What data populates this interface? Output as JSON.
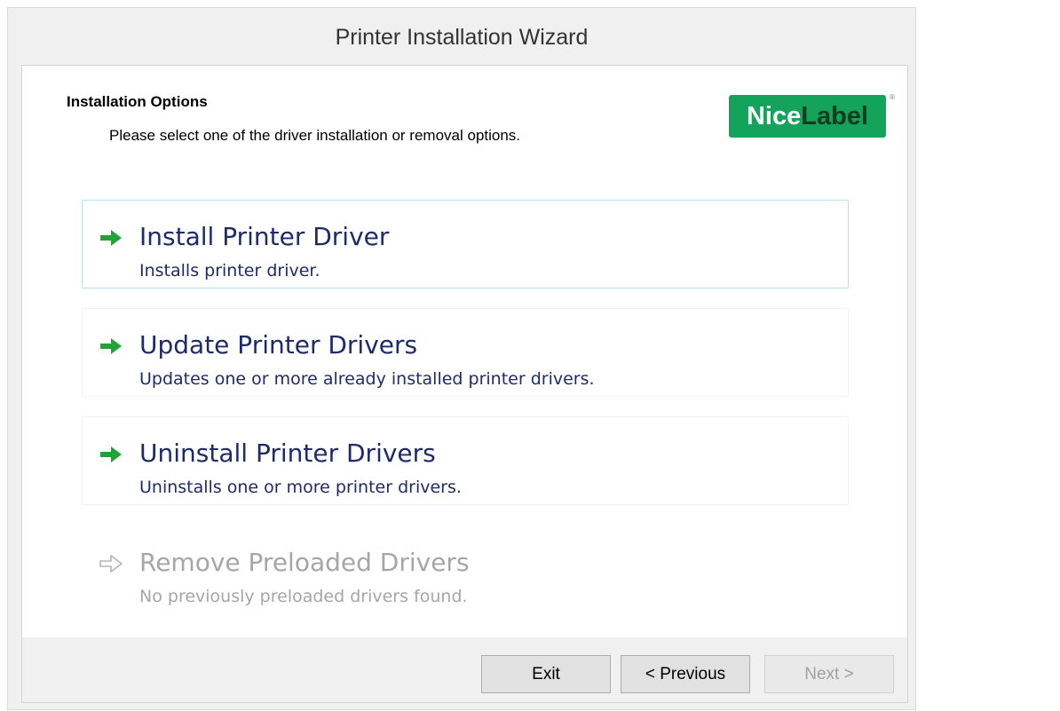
{
  "window": {
    "title": "Printer Installation Wizard"
  },
  "header": {
    "title": "Installation Options",
    "subtitle": "Please select one of the driver installation or removal options."
  },
  "logo": {
    "part1": "Nice",
    "part2": "Label",
    "registered": "®",
    "colors": {
      "background": "#14a35a",
      "nice": "#ffffff",
      "label": "#0f3d1f"
    }
  },
  "options": [
    {
      "title": "Install Printer Driver",
      "description": "Installs printer driver.",
      "icon": "green-arrow-right-icon",
      "state": "selected"
    },
    {
      "title": "Update Printer Drivers",
      "description": "Updates one or more already installed printer drivers.",
      "icon": "green-arrow-right-icon",
      "state": "enabled"
    },
    {
      "title": "Uninstall Printer Drivers",
      "description": "Uninstalls one or more printer drivers.",
      "icon": "green-arrow-right-icon",
      "state": "enabled"
    },
    {
      "title": "Remove Preloaded Drivers",
      "description": "No previously preloaded drivers found.",
      "icon": "gray-arrow-right-icon",
      "state": "disabled"
    }
  ],
  "footer": {
    "exit_label": "Exit",
    "previous_label": "< Previous",
    "next_label": "Next >",
    "next_enabled": false
  },
  "colors": {
    "accent_arrow": "#21a336",
    "option_text": "#1e2b6b",
    "disabled_text": "#a6a6a6",
    "selected_border": "#b6dff0"
  }
}
